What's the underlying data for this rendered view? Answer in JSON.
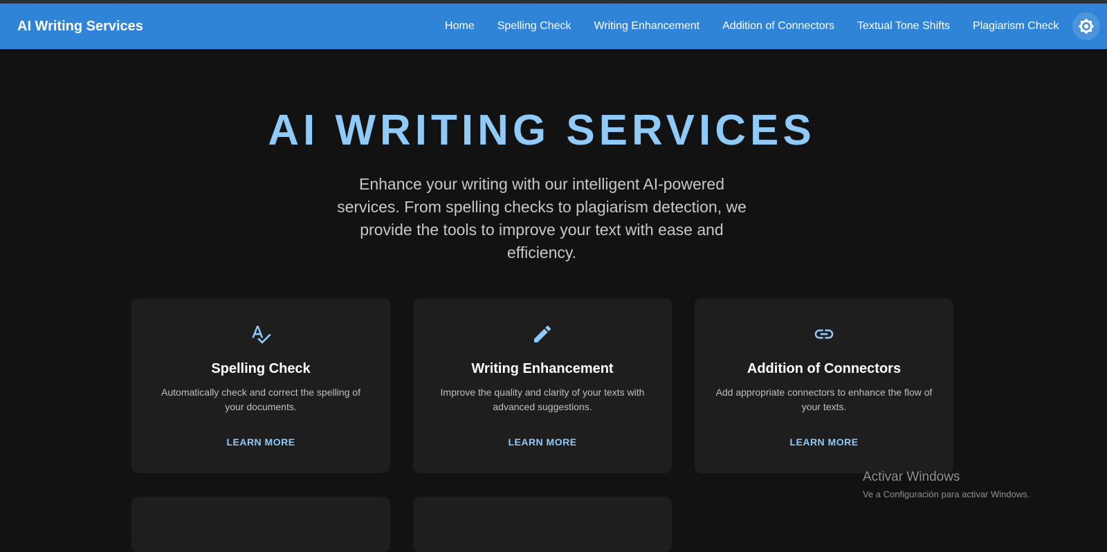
{
  "header": {
    "brand": "AI Writing Services",
    "nav": [
      {
        "label": "Home"
      },
      {
        "label": "Spelling Check"
      },
      {
        "label": "Writing Enhancement"
      },
      {
        "label": "Addition of Connectors"
      },
      {
        "label": "Textual Tone Shifts"
      },
      {
        "label": "Plagiarism Check"
      }
    ],
    "theme_toggle_icon": "sun-icon",
    "bar_color": "#2f84d8"
  },
  "hero": {
    "title": "AI WRITING SERVICES",
    "subtitle": "Enhance your writing with our intelligent AI-powered services. From spelling checks to plagiarism detection, we provide the tools to improve your text with ease and efficiency.",
    "title_color": "#90caf9"
  },
  "cards": [
    {
      "icon": "spellcheck-icon",
      "title": "Spelling Check",
      "description": "Automatically check and correct the spelling of your documents.",
      "link": "LEARN MORE"
    },
    {
      "icon": "pencil-icon",
      "title": "Writing Enhancement",
      "description": "Improve the quality and clarity of your texts with advanced suggestions.",
      "link": "LEARN MORE"
    },
    {
      "icon": "link-icon",
      "title": "Addition of Connectors",
      "description": "Add appropriate connectors to enhance the flow of your texts.",
      "link": "LEARN MORE"
    }
  ],
  "watermark": {
    "title": "Activar Windows",
    "subtitle": "Ve a Configuración para activar Windows."
  }
}
